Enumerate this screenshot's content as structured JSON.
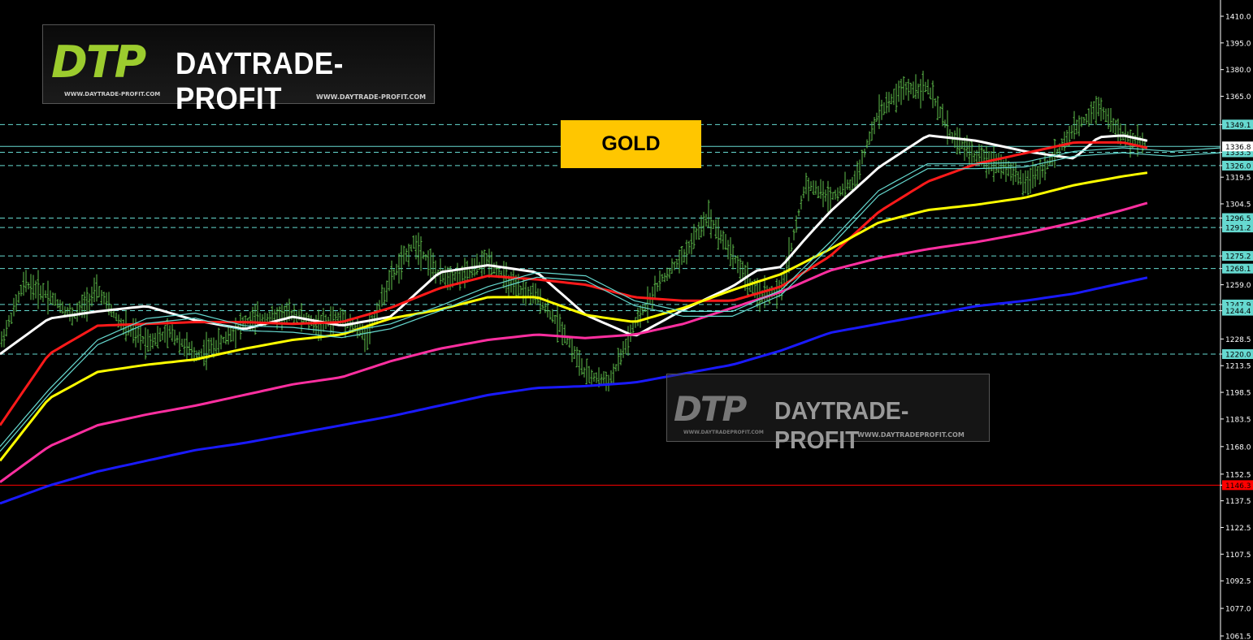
{
  "header": {
    "logo_mark": "DTP",
    "brand": "DAYTRADE-PROFIT",
    "url_left": "WWW.DAYTRADE-PROFIT.COM",
    "url_right": "WWW.DAYTRADE-PROFIT.COM"
  },
  "watermark": {
    "logo_mark": "DTP",
    "brand": "DAYTRADE-PROFIT",
    "url_left": "WWW.DAYTRADEPROFIT.COM",
    "url_right": "WWW.DAYTRADEPROFIT.COM"
  },
  "badge": {
    "label": "GOLD"
  },
  "colors": {
    "background": "#000000",
    "candles": "#5fbf4b",
    "level_lines": "#66d9d0",
    "ma_white": "#ffffff",
    "ma_red": "#ff1a1a",
    "ma_yellow": "#ffff00",
    "ma_pink": "#ff2fa0",
    "ma_blue": "#1a1aff",
    "envelope": "#66d9d0",
    "current_price_line": "#ff0000",
    "badge": "#ffc600"
  },
  "chart_data": {
    "type": "line",
    "instrument": "GOLD",
    "ylim": [
      1061.5,
      1410.0
    ],
    "y_ticks": [
      1410.0,
      1395.0,
      1380.0,
      1365.0,
      1349.1,
      1333.5,
      1326.0,
      1319.5,
      1304.5,
      1296.5,
      1291.2,
      1275.2,
      1268.1,
      1259.0,
      1247.9,
      1244.4,
      1228.5,
      1220.0,
      1213.5,
      1198.5,
      1183.5,
      1168.0,
      1152.5,
      1146.3,
      1137.5,
      1122.5,
      1107.5,
      1092.5,
      1077.0,
      1061.5
    ],
    "highlighted_levels": [
      1349.1,
      1333.5,
      1326.0,
      1296.5,
      1291.2,
      1275.2,
      1268.1,
      1247.9,
      1244.4,
      1220.0
    ],
    "current_price": 1146.3,
    "close_tag": 1336.8,
    "grid": false,
    "x_range": [
      0,
      100
    ],
    "price_range_x_end": 94,
    "price_series": {
      "name": "",
      "x": [
        0,
        2,
        4,
        6,
        8,
        10,
        12,
        14,
        16,
        18,
        20,
        22,
        24,
        26,
        28,
        30,
        32,
        34,
        36,
        38,
        40,
        42,
        44,
        46,
        48,
        50,
        52,
        54,
        56,
        58,
        60,
        62,
        64,
        66,
        68,
        70,
        72,
        74,
        76,
        78,
        80,
        82,
        84,
        86,
        88,
        90,
        92,
        94
      ],
      "values": [
        1225,
        1260,
        1253,
        1241,
        1256,
        1236,
        1227,
        1232,
        1219,
        1226,
        1238,
        1241,
        1243,
        1236,
        1241,
        1230,
        1262,
        1283,
        1264,
        1264,
        1273,
        1258,
        1252,
        1235,
        1208,
        1205,
        1236,
        1260,
        1275,
        1298,
        1276,
        1253,
        1255,
        1316,
        1308,
        1317,
        1356,
        1369,
        1370,
        1342,
        1331,
        1327,
        1316,
        1328,
        1346,
        1360,
        1342,
        1338
      ]
    },
    "series": [
      {
        "name": "",
        "color": "#ffffff",
        "x": [
          0,
          4,
          8,
          12,
          16,
          20,
          24,
          28,
          32,
          36,
          40,
          44,
          48,
          52,
          56,
          60,
          62,
          64,
          66,
          68,
          72,
          76,
          80,
          84,
          88,
          90,
          92,
          94
        ],
        "values": [
          1220,
          1240,
          1244,
          1247,
          1239,
          1234,
          1241,
          1236,
          1241,
          1266,
          1270,
          1266,
          1242,
          1230,
          1245,
          1258,
          1267,
          1269,
          1285,
          1300,
          1325,
          1343,
          1340,
          1334,
          1330,
          1342,
          1343,
          1340
        ]
      },
      {
        "name": "",
        "color": "#ff1a1a",
        "x": [
          0,
          4,
          8,
          12,
          16,
          20,
          24,
          28,
          32,
          36,
          40,
          44,
          48,
          52,
          56,
          60,
          64,
          68,
          72,
          76,
          80,
          84,
          88,
          92,
          94
        ],
        "values": [
          1180,
          1220,
          1236,
          1237,
          1238,
          1238,
          1237,
          1238,
          1246,
          1257,
          1264,
          1262,
          1259,
          1252,
          1250,
          1250,
          1258,
          1275,
          1300,
          1317,
          1327,
          1333,
          1339,
          1339,
          1336
        ]
      },
      {
        "name": "",
        "color": "#ffff00",
        "x": [
          0,
          4,
          8,
          12,
          16,
          20,
          24,
          28,
          32,
          36,
          40,
          44,
          48,
          52,
          56,
          60,
          64,
          68,
          72,
          76,
          80,
          84,
          88,
          92,
          94
        ],
        "values": [
          1160,
          1195,
          1210,
          1214,
          1217,
          1223,
          1228,
          1231,
          1240,
          1245,
          1252,
          1252,
          1242,
          1238,
          1246,
          1256,
          1265,
          1279,
          1294,
          1301,
          1304,
          1308,
          1315,
          1320,
          1322
        ]
      },
      {
        "name": "",
        "color": "#ff2fa0",
        "x": [
          0,
          4,
          8,
          12,
          16,
          20,
          24,
          28,
          32,
          36,
          40,
          44,
          48,
          52,
          56,
          60,
          64,
          68,
          72,
          76,
          80,
          84,
          88,
          92,
          94
        ],
        "values": [
          1148,
          1168,
          1180,
          1186,
          1191,
          1197,
          1203,
          1207,
          1216,
          1223,
          1228,
          1231,
          1229,
          1231,
          1237,
          1246,
          1255,
          1267,
          1274,
          1279,
          1283,
          1288,
          1294,
          1301,
          1305
        ]
      },
      {
        "name": "",
        "color": "#1a1aff",
        "x": [
          0,
          4,
          8,
          12,
          16,
          20,
          24,
          28,
          32,
          36,
          40,
          44,
          48,
          52,
          56,
          60,
          64,
          68,
          72,
          76,
          80,
          84,
          88,
          92,
          94
        ],
        "values": [
          1136,
          1146,
          1154,
          1160,
          1166,
          1170,
          1175,
          1180,
          1185,
          1191,
          1197,
          1201,
          1202,
          1204,
          1209,
          1214,
          1222,
          1232,
          1237,
          1242,
          1247,
          1250,
          1254,
          1260,
          1263
        ]
      },
      {
        "name": "",
        "color": "#66d9d0",
        "x": [
          0,
          4,
          8,
          12,
          16,
          20,
          24,
          28,
          32,
          36,
          40,
          44,
          48,
          52,
          56,
          60,
          64,
          68,
          72,
          76,
          80,
          84,
          88,
          92,
          96,
          100
        ],
        "values": [
          1168,
          1200,
          1228,
          1240,
          1243,
          1236,
          1235,
          1232,
          1237,
          1247,
          1258,
          1266,
          1264,
          1250,
          1244,
          1244,
          1256,
          1283,
          1312,
          1327,
          1327,
          1328,
          1334,
          1336,
          1334,
          1336
        ]
      }
    ]
  }
}
